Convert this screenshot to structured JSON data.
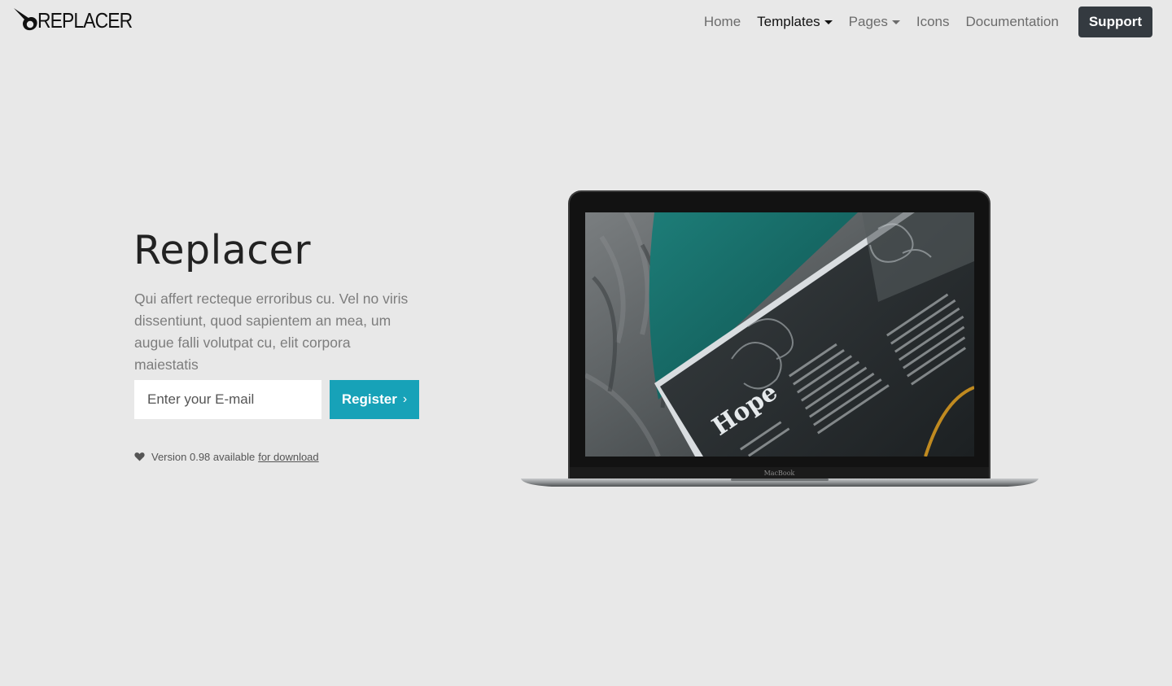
{
  "brand": {
    "name": "REPLACER"
  },
  "nav": {
    "items": [
      {
        "label": "Home",
        "dropdown": false,
        "active": false
      },
      {
        "label": "Templates",
        "dropdown": true,
        "active": true
      },
      {
        "label": "Pages",
        "dropdown": true,
        "active": false
      },
      {
        "label": "Icons",
        "dropdown": false,
        "active": false
      },
      {
        "label": "Documentation",
        "dropdown": false,
        "active": false
      }
    ],
    "support_label": "Support"
  },
  "hero": {
    "title": "Replacer",
    "text": "Qui affert recteque erroribus cu. Vel no viris dissentiunt, quod sapientem an mea, um augue falli volutpat cu, elit corpora maiestatis",
    "email_placeholder": "Enter your E-mail",
    "register_label": "Register",
    "register_icon": "chevron-right-icon",
    "version_text": "Version 0.98 available",
    "version_link": "for download"
  },
  "laptop": {
    "model_label": "MacBook",
    "screen_text": "Hope"
  },
  "colors": {
    "background": "#e8e8e8",
    "accent": "#17a2b8",
    "support_button": "#343a40"
  }
}
